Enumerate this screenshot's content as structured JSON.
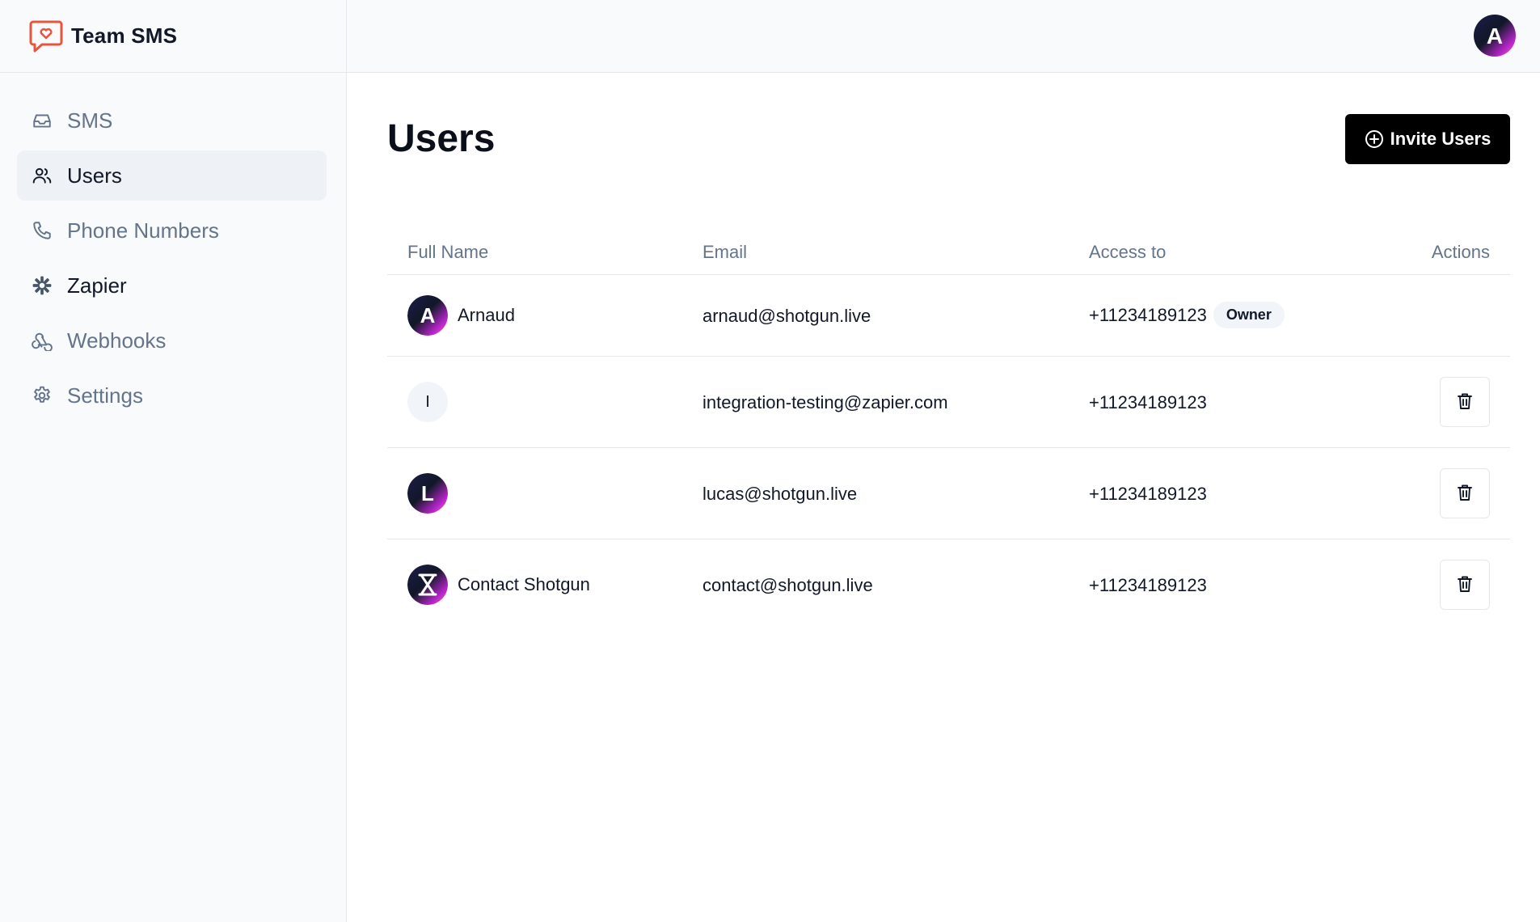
{
  "app": {
    "name": "Team SMS",
    "logo_icon": "chat-heart-icon",
    "accent_color": "#e8553d"
  },
  "sidebar": {
    "items": [
      {
        "label": "SMS",
        "icon": "inbox-icon",
        "active": false
      },
      {
        "label": "Users",
        "icon": "users-icon",
        "active": true
      },
      {
        "label": "Phone Numbers",
        "icon": "phone-icon",
        "active": false
      },
      {
        "label": "Zapier",
        "icon": "zapier-asterisk-icon",
        "active": false
      },
      {
        "label": "Webhooks",
        "icon": "webhook-icon",
        "active": false
      },
      {
        "label": "Settings",
        "icon": "gear-icon",
        "active": false
      }
    ]
  },
  "header": {
    "avatar_letter": "A"
  },
  "page": {
    "title": "Users",
    "invite_label": "Invite Users"
  },
  "table": {
    "columns": [
      "Full Name",
      "Email",
      "Access to",
      "Actions"
    ],
    "rows": [
      {
        "avatar": "A",
        "name": "Arnaud",
        "email": "arnaud@shotgun.live",
        "access": "+11234189123",
        "badge": "Owner",
        "deletable": false
      },
      {
        "avatar": "I",
        "name": "",
        "email": "integration-testing@zapier.com",
        "access": "+11234189123",
        "badge": "",
        "deletable": true
      },
      {
        "avatar": "L",
        "name": "",
        "email": "lucas@shotgun.live",
        "access": "+11234189123",
        "badge": "",
        "deletable": true
      },
      {
        "avatar": "hourglass-icon",
        "name": "Contact Shotgun",
        "email": "contact@shotgun.live",
        "access": "+11234189123",
        "badge": "",
        "deletable": true
      }
    ]
  }
}
